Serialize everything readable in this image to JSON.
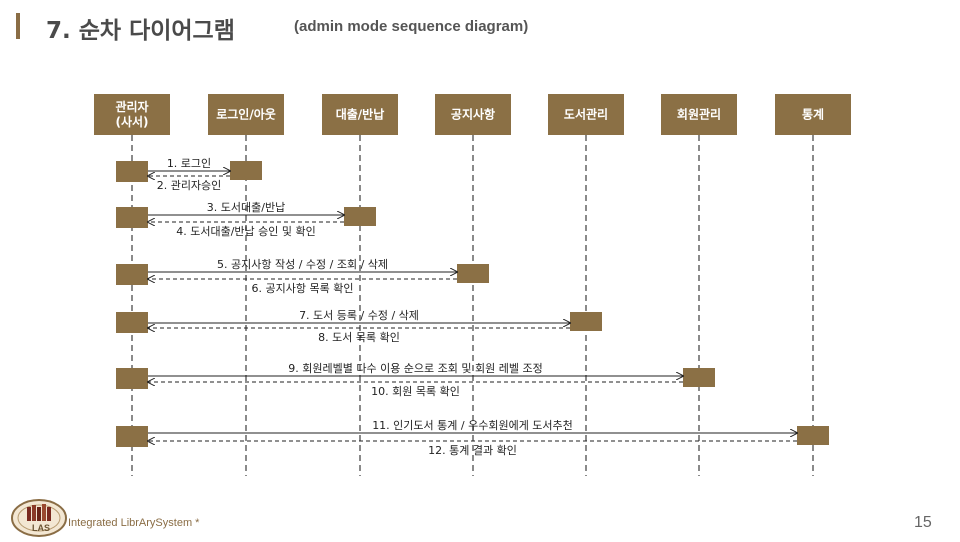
{
  "header": {
    "title": "7.  순차 다이어그램",
    "subtitle": "(admin mode sequence diagram)"
  },
  "colors": {
    "box": "#8b7045",
    "box_text": "#ffffff",
    "lifeline": "#8a8a8a",
    "arrow": "#222222"
  },
  "lifelines": [
    {
      "label": "관리자\n(사서)"
    },
    {
      "label": "로그인/아웃"
    },
    {
      "label": "대출/반납"
    },
    {
      "label": "공지사항"
    },
    {
      "label": "도서관리"
    },
    {
      "label": "회원관리"
    },
    {
      "label": "통계"
    }
  ],
  "messages": [
    {
      "from": 0,
      "to": 1,
      "label": "1. 로그인",
      "type": "solid"
    },
    {
      "from": 1,
      "to": 0,
      "label": "2. 관리자승인",
      "type": "dashed"
    },
    {
      "from": 0,
      "to": 2,
      "label": "3. 도서대출/반납",
      "type": "solid"
    },
    {
      "from": 2,
      "to": 0,
      "label": "4. 도서대출/반납 승인 및 확인",
      "type": "dashed"
    },
    {
      "from": 0,
      "to": 3,
      "label": "5. 공지사항 작성 / 수정 / 조회 / 삭제",
      "type": "solid"
    },
    {
      "from": 3,
      "to": 0,
      "label": "6. 공지사항 목록 확인",
      "type": "dashed"
    },
    {
      "from": 0,
      "to": 4,
      "label": "7. 도서 등록 / 수정 / 삭제",
      "type": "solid"
    },
    {
      "from": 4,
      "to": 0,
      "label": "8. 도서 목록 확인",
      "type": "dashed"
    },
    {
      "from": 0,
      "to": 5,
      "label": "9. 회원레벨별 다수 이용 순으로 조회 및 회원 레벨 조정",
      "type": "solid"
    },
    {
      "from": 5,
      "to": 0,
      "label": "10. 회원 목록 확인",
      "type": "dashed"
    },
    {
      "from": 0,
      "to": 6,
      "label": "11. 인기도서 통계 / 우수회원에게 도서추천",
      "type": "solid"
    },
    {
      "from": 6,
      "to": 0,
      "label": "12. 통계 결과 확인",
      "type": "dashed"
    }
  ],
  "footer": {
    "logo_text": "LAS",
    "brand": "Integrated LibrArySystem *",
    "page_number": "15"
  }
}
